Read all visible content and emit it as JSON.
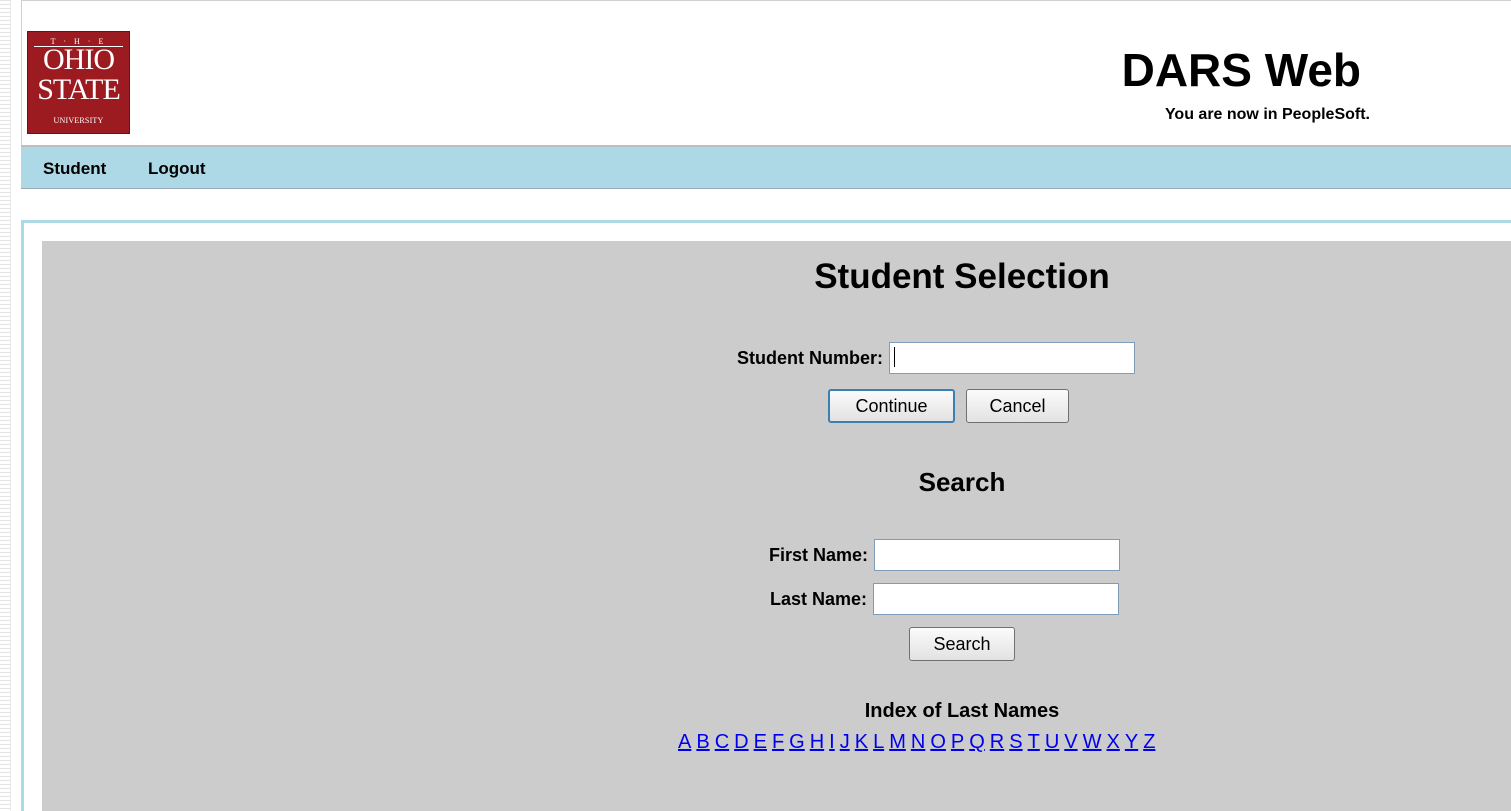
{
  "logo": {
    "line1": "T · H · E",
    "line2": "OHIO",
    "line3": "STATE",
    "line4": "UNIVERSITY"
  },
  "header": {
    "title": "DARS Web",
    "subtitle": "You are now in PeopleSoft."
  },
  "nav": {
    "items": [
      {
        "label": "Student"
      },
      {
        "label": "Logout"
      }
    ]
  },
  "selection": {
    "heading": "Student Selection",
    "student_number_label": "Student Number:",
    "student_number_value": "",
    "continue_label": "Continue",
    "cancel_label": "Cancel"
  },
  "search": {
    "heading": "Search",
    "first_name_label": "First Name:",
    "first_name_value": "",
    "last_name_label": "Last Name:",
    "last_name_value": "",
    "search_button_label": "Search"
  },
  "index": {
    "title": "Index of Last Names",
    "letters": [
      "A",
      "B",
      "C",
      "D",
      "E",
      "F",
      "G",
      "H",
      "I",
      "J",
      "K",
      "L",
      "M",
      "N",
      "O",
      "P",
      "Q",
      "R",
      "S",
      "T",
      "U",
      "V",
      "W",
      "X",
      "Y",
      "Z"
    ]
  },
  "colors": {
    "nav_bg": "#add8e6",
    "panel_bg": "#cccccc",
    "logo_red": "#9b1b20",
    "link": "#0000ee"
  }
}
